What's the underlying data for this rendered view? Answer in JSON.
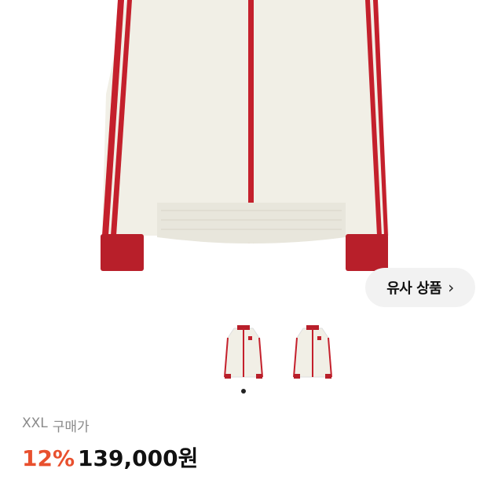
{
  "product": {
    "image_icon": "track-jacket-image",
    "thumbnails": [
      "track-jacket-thumbnail-front",
      "track-jacket-thumbnail-front-alt"
    ],
    "colors": {
      "body": "#f1efe6",
      "stripe": "#c4202c",
      "cuff": "#b81f2a"
    }
  },
  "similar_button": {
    "label": "유사 상품",
    "chevron": "›"
  },
  "pager": {
    "active_index": 1,
    "total": 1
  },
  "listing": {
    "size": "XXL",
    "size_suffix": "구매가",
    "discount": "12%",
    "price": "139,000원",
    "discount_color": "#e8502e"
  }
}
